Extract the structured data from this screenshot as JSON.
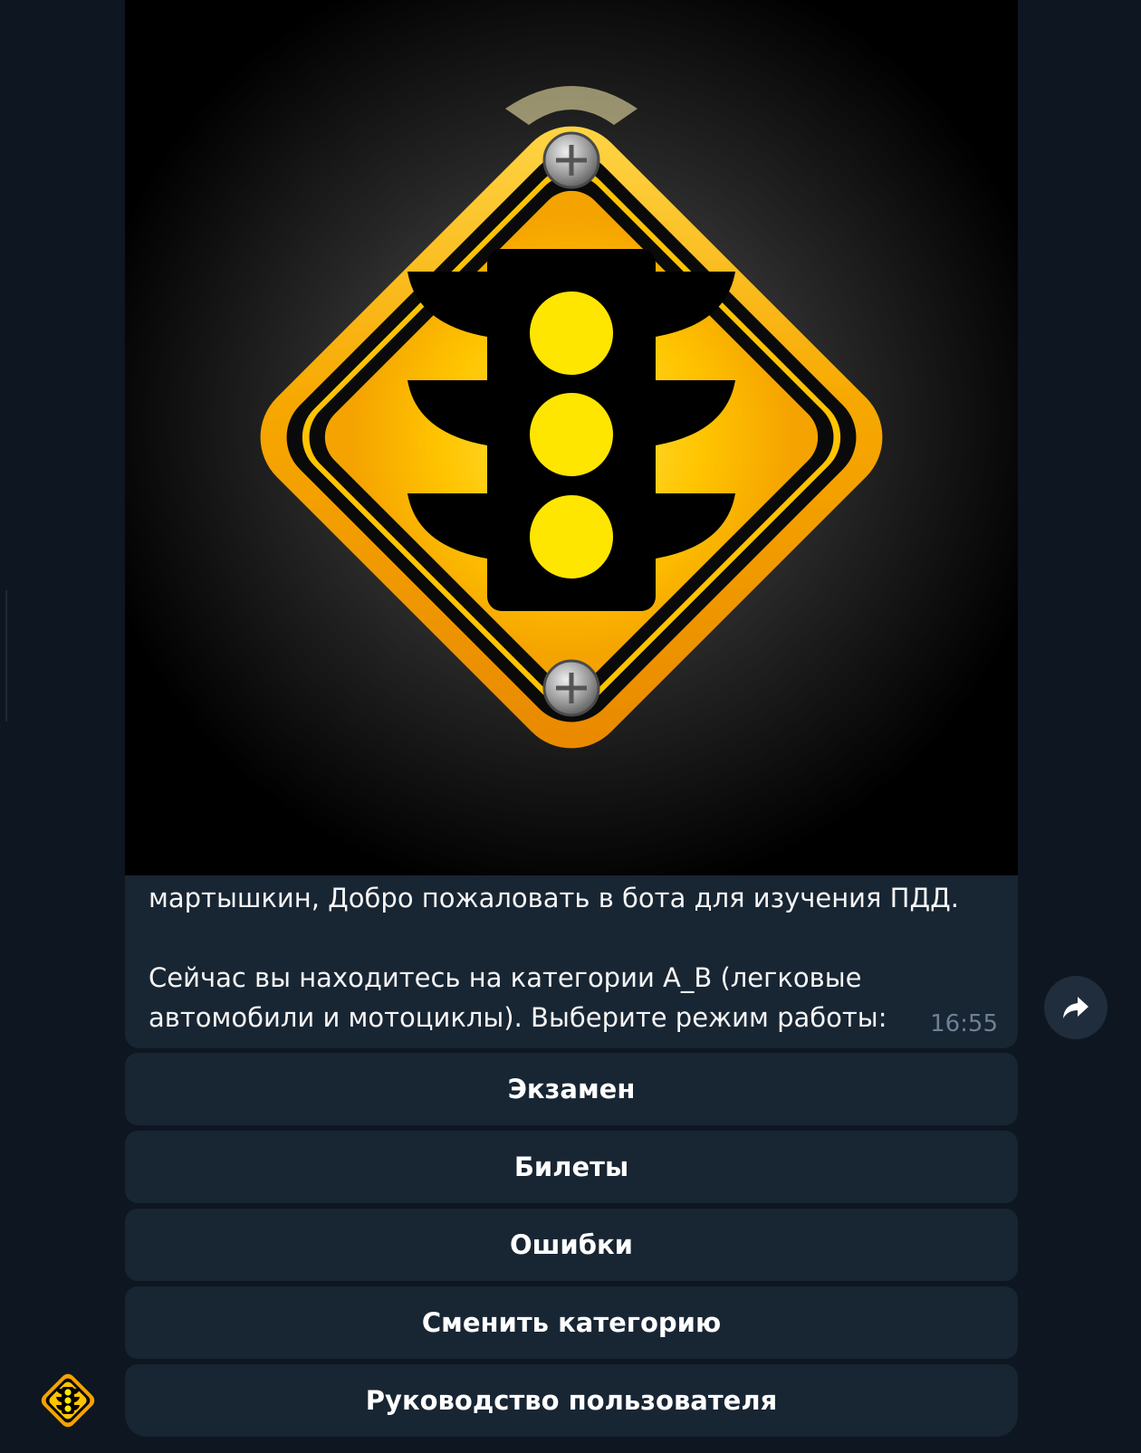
{
  "message": {
    "caption_line1": "мартышкин, Добро пожаловать в бота для изучения ПДД.",
    "caption_line2": "Сейчас вы находитесь на категории A_B (легковые автомобили и мотоциклы). Выберите режим работы:",
    "time": "16:55",
    "photo_icon": "traffic-light-warning-sign"
  },
  "keyboard": {
    "buttons": [
      {
        "label": "Экзамен"
      },
      {
        "label": "Билеты"
      },
      {
        "label": "Ошибки"
      },
      {
        "label": "Сменить категорию"
      },
      {
        "label": "Руководство пользователя"
      }
    ]
  },
  "icons": {
    "forward": "forward-arrow-icon",
    "avatar": "traffic-light-icon"
  },
  "colors": {
    "background": "#0e1621",
    "bubble": "#182533",
    "sign_yellow": "#ffc400",
    "sign_orange": "#f49c00",
    "text": "#f5f5f5",
    "time": "#6d8196"
  }
}
